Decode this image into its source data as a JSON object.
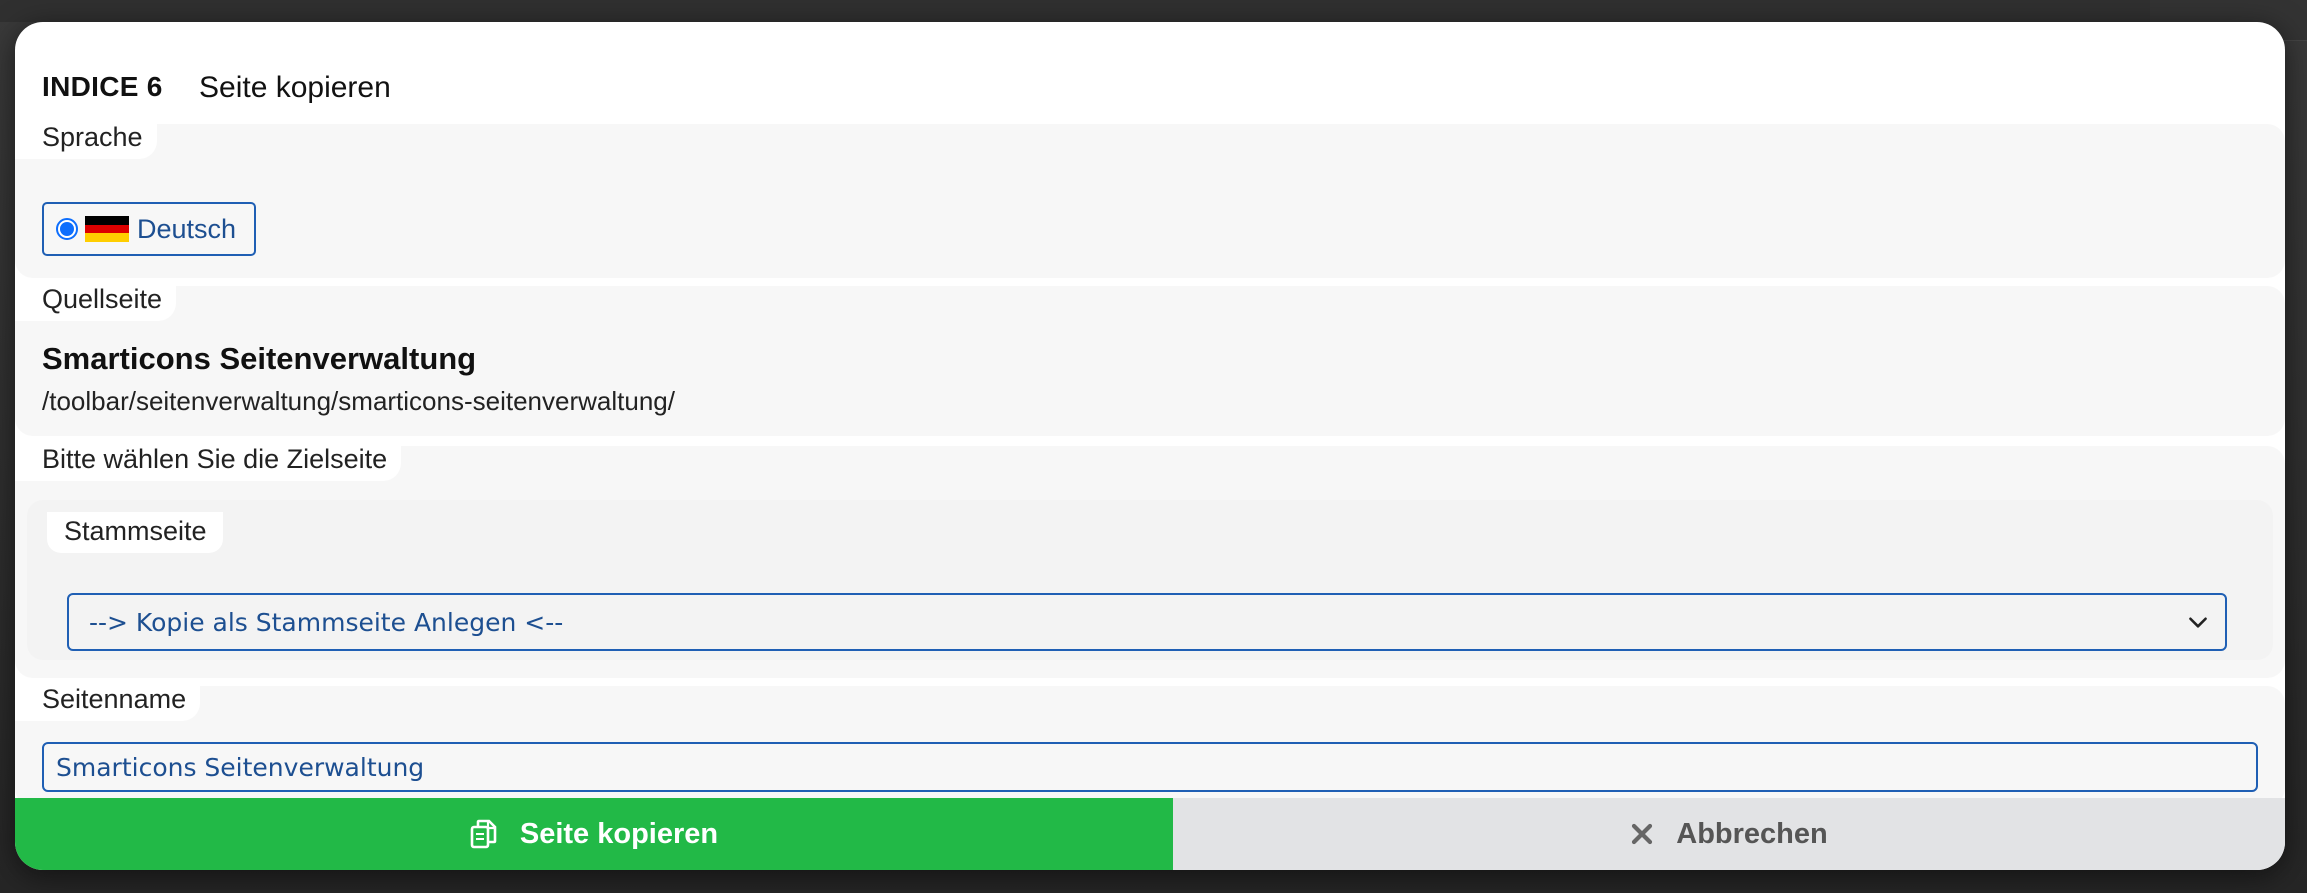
{
  "header": {
    "brand": "INDICE 6",
    "title": "Seite kopieren"
  },
  "language": {
    "legend": "Sprache",
    "option_label": "Deutsch",
    "selected": true,
    "flag_colors": [
      "#000000",
      "#dd0000",
      "#ffce00"
    ]
  },
  "source": {
    "legend": "Quellseite",
    "title": "Smarticons Seitenverwaltung",
    "path": "/toolbar/seitenverwaltung/smarticons-seitenverwaltung/"
  },
  "target": {
    "legend": "Bitte wählen Sie die Zielseite",
    "parent_legend": "Stammseite",
    "parent_selected": "--> Kopie als Stammseite Anlegen <--"
  },
  "page_name": {
    "legend": "Seitenname",
    "value": "Smarticons Seitenverwaltung"
  },
  "buttons": {
    "copy_label": "Seite kopieren",
    "copy_icon": "copy-icon",
    "cancel_label": "Abbrechen",
    "cancel_icon": "close-icon"
  },
  "colors": {
    "accent_blue": "#1f5fb4",
    "copy_green": "#22b947",
    "cancel_gray": "#e2e3e5"
  }
}
